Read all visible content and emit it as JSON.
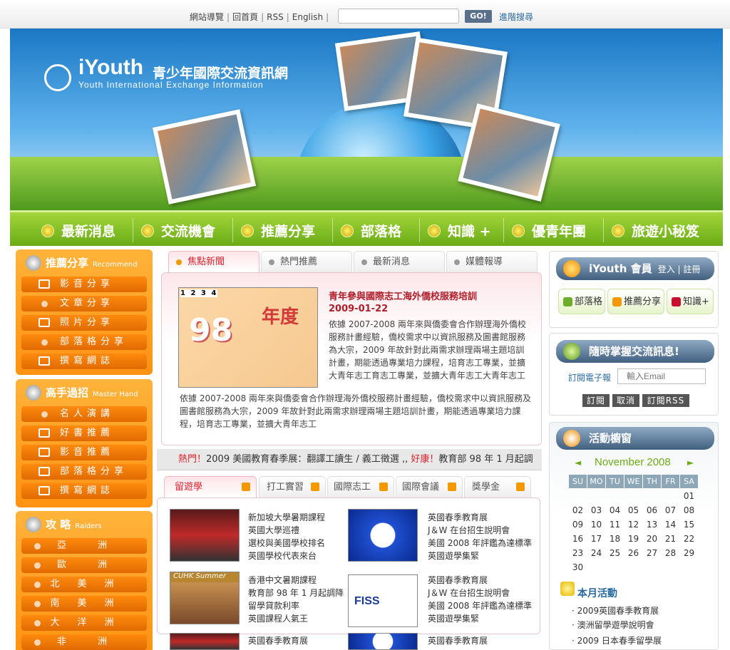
{
  "topbar": {
    "links": [
      "網站導覽",
      "回首頁",
      "RSS",
      "English"
    ],
    "search_placeholder": "",
    "go_label": "GO!",
    "advanced_label": "進階搜尋"
  },
  "banner": {
    "logo_en": "iYouth",
    "logo_zh": "青少年國際交流資訊網",
    "logo_sub": "Youth International Exchange Information"
  },
  "mainnav": [
    "最新消息",
    "交流機會",
    "推薦分享",
    "部落格",
    "知識 +",
    "優青年團",
    "旅遊小秘笈"
  ],
  "left": {
    "recommend": {
      "title": "推薦分享",
      "title_en": "Recommend",
      "items": [
        "影音分享",
        "文章分享",
        "照片分享",
        "部落格分享",
        "撰寫網誌"
      ]
    },
    "master": {
      "title": "高手過招",
      "title_en": "Master Hand",
      "items": [
        "名人演講",
        "好書推薦",
        "影音推薦",
        "部落格分享",
        "撰寫網誌"
      ]
    },
    "raiders": {
      "title": "攻 略",
      "title_en": "Raiders",
      "items": [
        "亞　　洲",
        "歐　　洲",
        "北　美　洲",
        "南　美　洲",
        "大　洋　洲",
        "非　　洲"
      ]
    }
  },
  "news": {
    "tabs": [
      "焦點新聞",
      "熱門推薦",
      "最新消息",
      "媒體報導"
    ],
    "image_nums": "1 2 3 4",
    "image_big": "98",
    "image_text": "年度",
    "title": "青年參與國際志工海外僑校服務培訓",
    "date": "2009-01-22",
    "body": "依據 2007-2008 兩年來與僑委會合作辦理海外僑校服務計畫經驗，僑校需求中以資訊服務及圖書館服務為大宗，2009 年故針對此兩需求辦理兩場主題培訓計畫，期能透過專業培力課程，培育志工專業，並擴大青年志工育志工專業，並擴大青年志工大青年志工",
    "body2": "依據 2007-2008 兩年來與僑委會合作辦理海外僑校服務計畫經驗，僑校需求中以資訊服務及圖書館服務為大宗，2009 年故針對此兩需求辦理兩場主題培訓計畫，期能透過專業培力課程，培育志工專業，並擴大青年志工"
  },
  "ticker": {
    "hot1": "熱門！",
    "text1": "2009 美國教育春季展：翻譯工讀生 / 義工徵選 ,, ",
    "hot2": "好康！",
    "text2": "教育部 98 年 1 月起調"
  },
  "study": {
    "tabs": [
      "留遊學",
      "打工實習",
      "國際志工",
      "國際會議",
      "獎學金"
    ],
    "blocks": [
      {
        "lines": [
          "新加坡大學暑期課程",
          "英國大學巡禮",
          "選校與美國學校排名",
          "英國學校代表來台"
        ]
      },
      {
        "lines": [
          "英國春季教育展",
          "J＆W 在台招生說明會",
          "美國 2008 年評鑑為達標準",
          "英國遊學集緊"
        ]
      },
      {
        "thumb_label": "CUHK Summer",
        "lines": [
          "香港中文暑期課程",
          "教育部 98 年 1 月起調降",
          "留學貸款利率",
          "英國課程人氣王"
        ]
      },
      {
        "thumb_label": "FISS",
        "lines": [
          "英國春季教育展",
          "J＆W 在台招生說明會",
          "美國 2008 年評鑑為達標準",
          "英國遊學集緊"
        ]
      },
      {
        "lines": [
          "英國春季教育展"
        ]
      },
      {
        "lines": [
          "英國春季教育展"
        ]
      }
    ]
  },
  "member": {
    "title": "iYouth 會員",
    "login": "登入 | 註冊",
    "buttons": [
      "部落格",
      "推薦分享",
      "知識+"
    ]
  },
  "subscribe": {
    "title": "隨時掌握交流訊息!",
    "label": "訂閱電子報",
    "email_placeholder": "輸入Email",
    "buttons": [
      "訂閱",
      "取消",
      "訂閱RSS"
    ]
  },
  "calendar": {
    "title": "活動櫥窗",
    "month": "November 2008",
    "prev": "◄",
    "next": "►",
    "days": [
      "SU",
      "MO",
      "TU",
      "WE",
      "TH",
      "FR",
      "SA"
    ],
    "weeks": [
      [
        "",
        "",
        "",
        "",
        "",
        "",
        "01"
      ],
      [
        "02",
        "03",
        "04",
        "05",
        "06",
        "07",
        "08"
      ],
      [
        "09",
        "10",
        "11",
        "12",
        "13",
        "14",
        "15"
      ],
      [
        "16",
        "17",
        "18",
        "19",
        "20",
        "21",
        "22"
      ],
      [
        "23",
        "24",
        "25",
        "26",
        "27",
        "28",
        "29"
      ],
      [
        "30",
        "",
        "",
        "",
        "",
        "",
        ""
      ]
    ]
  },
  "events": {
    "title": "本月活動",
    "items": [
      "2009英國春季教育展",
      "澳洲留學遊學說明會",
      "2009 日本春季留學展"
    ]
  }
}
